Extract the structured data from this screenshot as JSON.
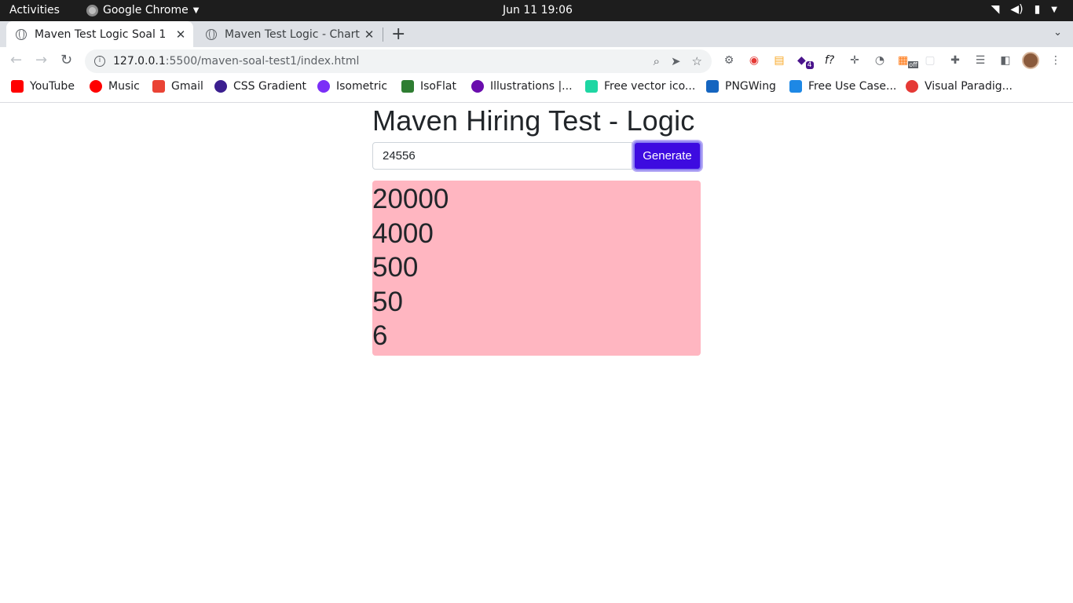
{
  "os": {
    "activities": "Activities",
    "app_menu": "Google Chrome",
    "clock": "Jun 11  19:06"
  },
  "tabs": [
    {
      "title": "Maven Test Logic Soal 1",
      "active": true
    },
    {
      "title": "Maven Test Logic - Chart D",
      "active": false
    }
  ],
  "address_bar": {
    "host": "127.0.0.1",
    "path": ":5500/maven-soal-test1/index.html"
  },
  "bookmarks": [
    {
      "label": "YouTube",
      "color": "#ff0000"
    },
    {
      "label": "Music",
      "color": "#ff0000"
    },
    {
      "label": "Gmail",
      "color": "#ea4335"
    },
    {
      "label": "CSS Gradient",
      "color": "#3b1f8f"
    },
    {
      "label": "Isometric",
      "color": "#7b2ff7"
    },
    {
      "label": "IsoFlat",
      "color": "#2e7d32"
    },
    {
      "label": "Illustrations |...",
      "color": "#6a0dad"
    },
    {
      "label": "Free vector ico...",
      "color": "#1ed6a3"
    },
    {
      "label": "PNGWing",
      "color": "#1565c0"
    },
    {
      "label": "Free Use Case...",
      "color": "#1e88e5"
    },
    {
      "label": "Visual Paradig...",
      "color": "#e53935"
    }
  ],
  "extensions": {
    "badge": "4",
    "off_badge": "off"
  },
  "page": {
    "heading": "Maven Hiring Test - Logic",
    "input_value": "24556",
    "generate_label": "Generate",
    "results": [
      "20000",
      "4000",
      "500",
      "50",
      "6"
    ],
    "result_bg": "#ffb6c1",
    "button_color": "#3d0be0"
  }
}
